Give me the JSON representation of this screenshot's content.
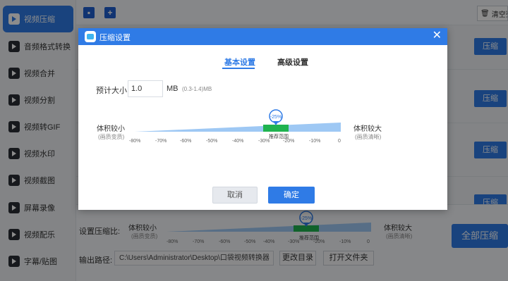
{
  "sidebar": {
    "items": [
      {
        "label": "视频压缩",
        "icon": "video-compress-icon",
        "active": true
      },
      {
        "label": "音频格式转换",
        "icon": "audio-convert-icon"
      },
      {
        "label": "视频合并",
        "icon": "video-merge-icon"
      },
      {
        "label": "视频分割",
        "icon": "video-split-icon"
      },
      {
        "label": "视频转GIF",
        "icon": "gif-icon"
      },
      {
        "label": "视频水印",
        "icon": "watermark-icon"
      },
      {
        "label": "视频截图",
        "icon": "screenshot-icon"
      },
      {
        "label": "屏幕录像",
        "icon": "screen-record-icon"
      },
      {
        "label": "视频配乐",
        "icon": "music-icon"
      },
      {
        "label": "字幕/贴图",
        "icon": "subtitle-icon"
      }
    ]
  },
  "toolbar": {
    "add_file_icon": "add-file-icon",
    "add_folder_icon": "add-folder-icon",
    "clear_label": "清空列"
  },
  "list": {
    "row_button_label": "压缩"
  },
  "bottom": {
    "ratio_label": "设置压缩比:",
    "small_label": "体积较小",
    "small_sub": "(画质变质)",
    "large_label": "体积较大",
    "large_sub": "(画质清晰)",
    "ticks": [
      "-80%",
      "-70%",
      "-60%",
      "-50%",
      "-40%",
      "-30%",
      "-20%",
      "-10%",
      "0"
    ],
    "value_badge": "-25%",
    "recommend_label": "推荐范围",
    "output_label": "输出路径:",
    "output_path": "C:\\Users\\Administrator\\Desktop\\口袋视频转换器",
    "change_dir_label": "更改目录",
    "open_folder_label": "打开文件夹",
    "compress_all_label": "全部压缩"
  },
  "dialog": {
    "title": "压缩设置",
    "close_glyph": "✕",
    "tabs": [
      "基本设置",
      "高级设置"
    ],
    "active_tab": 0,
    "size_label": "预计大小:",
    "size_value": "1.0",
    "size_unit": "MB",
    "size_range": "(0.3-1.4)MB",
    "small_label": "体积较小",
    "small_sub": "(画质变质)",
    "large_label": "体积较大",
    "large_sub": "(画质清晰)",
    "ticks": [
      "-80%",
      "-70%",
      "-60%",
      "-50%",
      "-40%",
      "-30%",
      "-20%",
      "-10%",
      "0"
    ],
    "value_badge": "-25%",
    "slider_value_percent": -25,
    "recommend_label": "推荐范围",
    "cancel_label": "取消",
    "ok_label": "确定"
  },
  "colors": {
    "accent": "#2f7be6",
    "recommend": "#1fb34f"
  }
}
